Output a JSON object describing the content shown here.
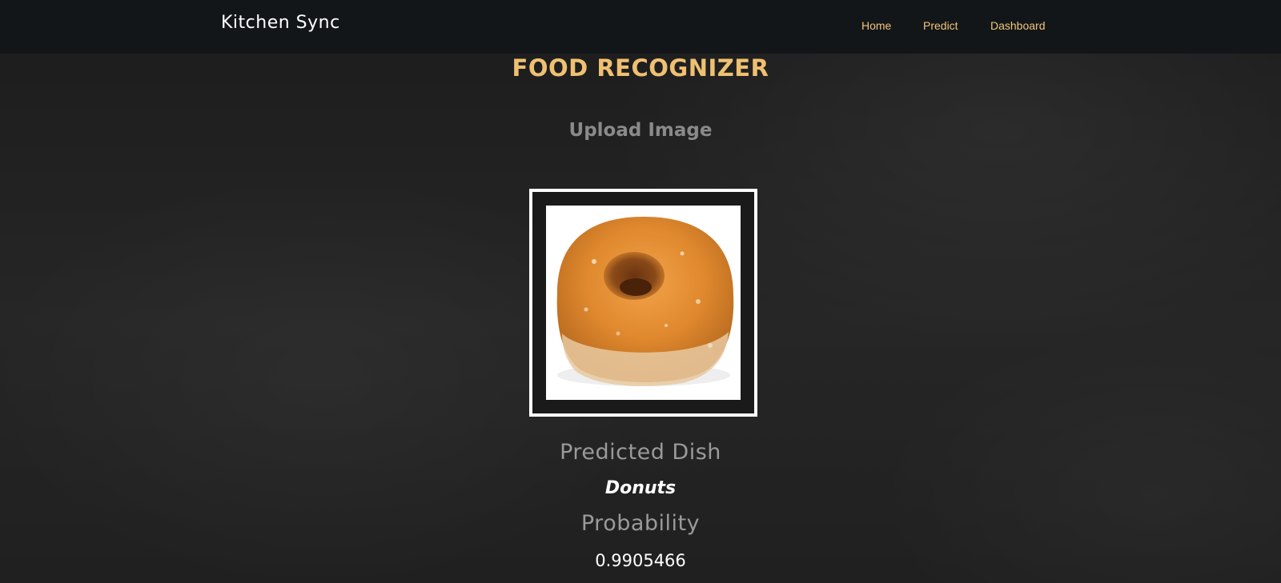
{
  "navbar": {
    "brand": "Kitchen Sync",
    "links": [
      {
        "label": "Home"
      },
      {
        "label": "Predict"
      },
      {
        "label": "Dashboard"
      }
    ]
  },
  "main": {
    "title": "FOOD RECOGNIZER",
    "upload_label": "Upload Image",
    "image": {
      "subject": "donut-image"
    },
    "predicted_label": "Predicted Dish",
    "predicted_value": "Donuts",
    "probability_label": "Probability",
    "probability_value": "0.9905466"
  },
  "colors": {
    "accent": "#efc072",
    "nav_link": "#f0c57a",
    "navbar_bg": "#131619",
    "page_bg": "#232323",
    "muted_text": "#9a9a9a"
  }
}
